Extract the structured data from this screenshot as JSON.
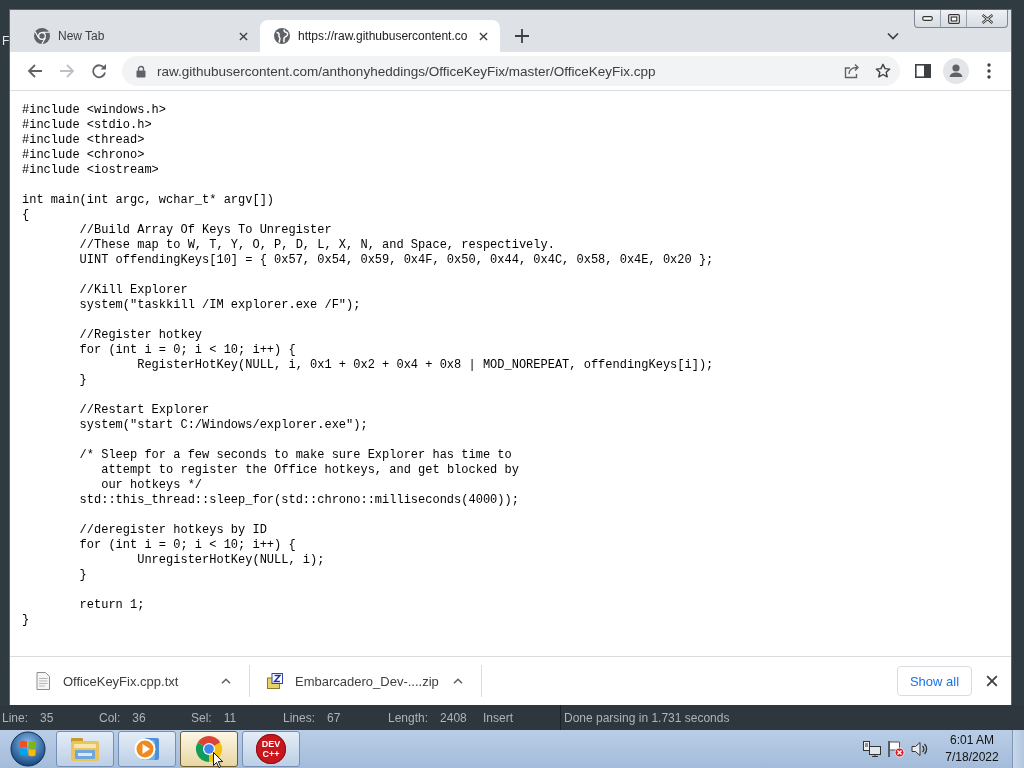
{
  "background_app": {
    "menu_fragment": "F",
    "status_bar": {
      "fields": [
        {
          "label": "Line:",
          "value": "35"
        },
        {
          "label": "Col:",
          "value": "36"
        },
        {
          "label": "Sel:",
          "value": "11"
        },
        {
          "label": "Lines:",
          "value": "67"
        },
        {
          "label": "Length:",
          "value": "2408"
        }
      ],
      "mode": "Insert",
      "message": "Done parsing in 1.731 seconds"
    }
  },
  "browser": {
    "tabs": [
      {
        "kind": "newtab",
        "title": "New Tab",
        "selected": false
      },
      {
        "kind": "web",
        "title": "https://raw.githubusercontent.co",
        "selected": true
      }
    ],
    "nav_buttons": [
      {
        "kind": "back",
        "disabled": false
      },
      {
        "kind": "forward",
        "disabled": true
      },
      {
        "kind": "reload",
        "disabled": false
      }
    ],
    "address_bar": {
      "url": "raw.githubusercontent.com/anthonyheddings/OfficeKeyFix/master/OfficeKeyFix.cpp"
    },
    "code_blocks": [
      [
        "#include <windows.h>",
        "#include <stdio.h>",
        "#include <thread>",
        "#include <chrono>",
        "#include <iostream>"
      ],
      [
        "int main(int argc, wchar_t* argv[])",
        "{",
        "\t//Build Array Of Keys To Unregister",
        "\t//These map to W, T, Y, O, P, D, L, X, N, and Space, respectively.",
        "\tUINT offendingKeys[10] = { 0x57, 0x54, 0x59, 0x4F, 0x50, 0x44, 0x4C, 0x58, 0x4E, 0x20 };"
      ],
      [
        "\t//Kill Explorer",
        "\tsystem(\"taskkill /IM explorer.exe /F\");"
      ],
      [
        "\t//Register hotkey",
        "\tfor (int i = 0; i < 10; i++) {",
        "\t\tRegisterHotKey(NULL, i, 0x1 + 0x2 + 0x4 + 0x8 | MOD_NOREPEAT, offendingKeys[i]);",
        "\t}"
      ],
      [
        "\t//Restart Explorer",
        "\tsystem(\"start C:/Windows/explorer.exe\");"
      ],
      [
        "\t/* Sleep for a few seconds to make sure Explorer has time to",
        "\t   attempt to register the Office hotkeys, and get blocked by",
        "\t   our hotkeys */",
        "\tstd::this_thread::sleep_for(std::chrono::milliseconds(4000));"
      ],
      [
        "\t//deregister hotkeys by ID",
        "\tfor (int i = 0; i < 10; i++) {",
        "\t\tUnregisterHotKey(NULL, i);",
        "\t}"
      ],
      [
        "\treturn 1;",
        "}"
      ]
    ],
    "downloads": [
      {
        "kind": "text",
        "file": "OfficeKeyFix.cpp.txt"
      },
      {
        "kind": "zip",
        "file": "Embarcadero_Dev-....zip"
      }
    ],
    "show_all": "Show all"
  },
  "taskbar": {
    "buttons": [
      {
        "kind": "explorer",
        "selected": false
      },
      {
        "kind": "media",
        "selected": false
      },
      {
        "kind": "chrome",
        "selected": true
      },
      {
        "kind": "devcpp",
        "selected": false,
        "logo_text": [
          "DEV",
          "C++"
        ]
      }
    ],
    "clock": {
      "time": "6:01 AM",
      "date": "7/18/2022"
    }
  }
}
